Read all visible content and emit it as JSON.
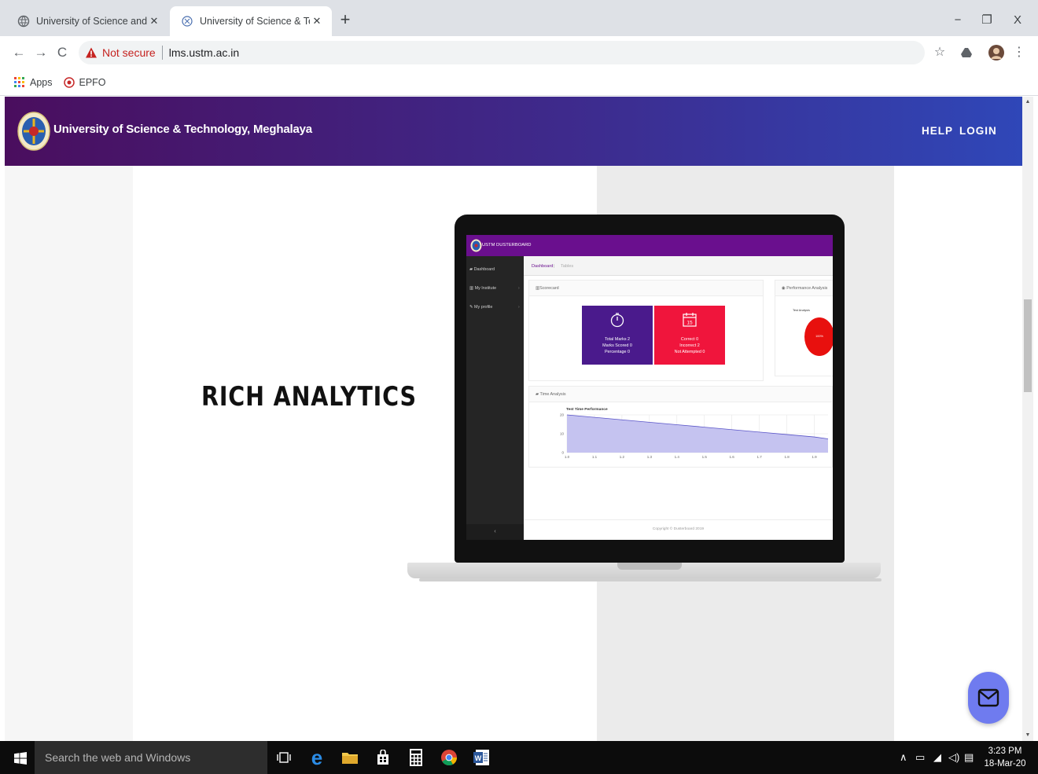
{
  "browser": {
    "tabs": [
      {
        "title": "University of Science and Techno",
        "active": false
      },
      {
        "title": "University of Science & Technolo",
        "active": true
      }
    ],
    "new_tab": "+",
    "window_controls": {
      "minimize": "−",
      "restore": "❐",
      "close": "X"
    },
    "security_label": "Not secure",
    "url": "lms.ustm.ac.in",
    "bookmarks": [
      {
        "label": "Apps",
        "icon": "apps-grid-icon"
      },
      {
        "label": "EPFO",
        "icon": "epfo-icon"
      }
    ]
  },
  "site": {
    "title": "University of Science & Technology, Meghalaya",
    "nav": {
      "help": "HELP",
      "login": "LOGIN"
    },
    "headline": "RICH ANALYTICS"
  },
  "mockup": {
    "brand": "USTM DUSTERBOARD",
    "sidebar": [
      {
        "label": "Dashboard",
        "icon": "dashboard-icon"
      },
      {
        "label": "My Institute",
        "icon": "institute-icon"
      },
      {
        "label": "My profile",
        "icon": "wrench-icon"
      }
    ],
    "sidebar_collapse": "‹",
    "breadcrumb": {
      "home": "Dashboard",
      "separator": "|",
      "current": "Tables"
    },
    "scorecard": {
      "title": "Scorecard",
      "tile1": {
        "line1": "Total Marks 2",
        "line2": "Marks Scored 0",
        "line3": "Percentage 0",
        "color": "#4a1a8c"
      },
      "tile2": {
        "day": "15",
        "line1": "Correct 0",
        "line2": "Incorrect 2",
        "line3": "Not Attempted 0",
        "color": "#f0153c"
      }
    },
    "performance": {
      "title": "Performance Analysis",
      "chart_title": "Test Analysis",
      "label": "100%",
      "color": "#e8100e"
    },
    "time_analysis": {
      "title": "Time Analysis",
      "chart_title": "Test Time Performance"
    },
    "footer": "Copyright © Dusterboard 2019"
  },
  "chart_data": {
    "type": "area",
    "title": "Test Time Performance",
    "x": [
      1.0,
      1.1,
      1.2,
      1.3,
      1.4,
      1.5,
      1.6,
      1.7,
      1.8,
      1.9
    ],
    "x_tick_labels": [
      "1.0",
      "1.1",
      "1.2",
      "1.3",
      "1.4",
      "1.5",
      "1.6",
      "1.7",
      "1.8",
      "1.9"
    ],
    "series": [
      {
        "values": [
          20,
          18.7,
          17.4,
          16.1,
          14.8,
          13.5,
          12.2,
          10.9,
          9.6,
          8.3
        ]
      }
    ],
    "y_tick_labels": [
      "0",
      "10",
      "20"
    ],
    "ylim": [
      0,
      20
    ],
    "fill_color": "#c5c3f0",
    "line_color": "#5a55c8",
    "grid": true
  },
  "taskbar": {
    "search_placeholder": "Search the web and Windows",
    "time": "3:23 PM",
    "date": "18-Mar-20"
  },
  "fab": {
    "icon": "mail-icon",
    "color": "#6f7bef"
  }
}
